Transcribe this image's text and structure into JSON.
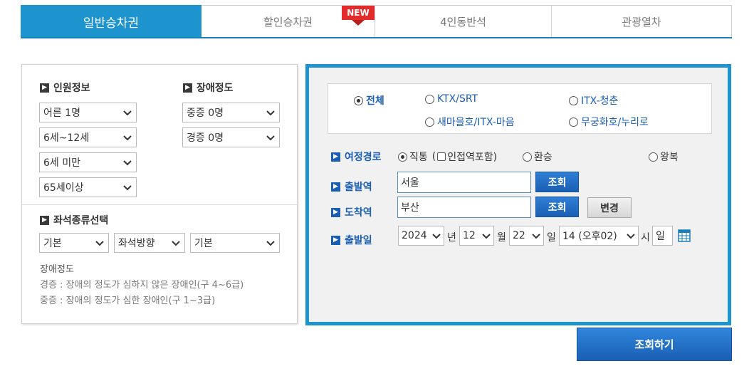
{
  "tabs": [
    {
      "label": "일반승차권"
    },
    {
      "label": "할인승차권"
    },
    {
      "label": "4인동반석"
    },
    {
      "label": "관광열차"
    }
  ],
  "new_badge": "NEW",
  "passengers": {
    "title": "인원정보",
    "adult": "어른 1명",
    "child": "6세~12세",
    "infant": "6세 미만",
    "senior": "65세이상"
  },
  "disability": {
    "title": "장애정도",
    "severe": "중증 0명",
    "mild": "경증 0명"
  },
  "seat": {
    "title": "좌석종류선택",
    "type": "기본",
    "direction": "좌석방향",
    "position": "기본"
  },
  "note": {
    "title": "장애정도",
    "line1": "경증 : 장애의 정도가 심하지 않은 장애인(구 4~6급)",
    "line2": "중증 : 장애의 정도가 심한 장애인(구 1~3급)"
  },
  "train_types": {
    "all": "전체",
    "ktx": "KTX/SRT",
    "itx_cheongchun": "ITX-청춘",
    "saemaeul": "새마을호/ITX-마음",
    "mugunghwa": "무궁화호/누리로"
  },
  "route": {
    "label": "여정경로",
    "direct": "직통",
    "adjacent_open": "(",
    "adjacent": "인접역포함)",
    "transfer": "환승",
    "round_trip": "왕복"
  },
  "departure": {
    "label": "출발역",
    "value": "서울",
    "lookup": "조회"
  },
  "arrival": {
    "label": "도착역",
    "value": "부산",
    "lookup": "조회",
    "swap": "변경"
  },
  "date": {
    "label": "출발일",
    "year": "2024",
    "year_unit": "년",
    "month": "12",
    "month_unit": "월",
    "day": "22",
    "day_unit": "일",
    "hour": "14 (오후02)",
    "hour_unit": "시",
    "weekday": "일"
  },
  "search_button": "조회하기",
  "colors": {
    "accent": "#1e94cf",
    "button_blue": "#1a5fb4",
    "badge_red": "#e22b2b"
  }
}
